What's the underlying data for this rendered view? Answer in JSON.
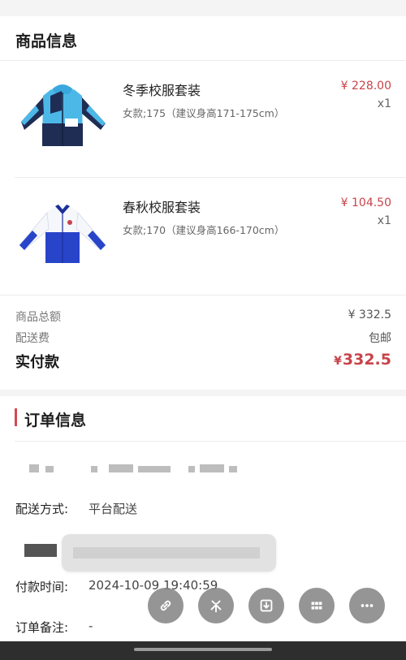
{
  "product_section": {
    "title": "商品信息",
    "items": [
      {
        "name": "冬季校服套装",
        "spec": "女款;175（建议身高171-175cm）",
        "price": "¥ 228.00",
        "qty": "x1",
        "image_icon": "winter-jacket-icon"
      },
      {
        "name": "春秋校服套装",
        "spec": "女款;170（建议身高166-170cm）",
        "price": "¥ 104.50",
        "qty": "x1",
        "image_icon": "spring-jacket-icon"
      }
    ]
  },
  "summary": {
    "subtotal_label": "商品总额",
    "subtotal_value": "¥ 332.5",
    "shipping_label": "配送费",
    "shipping_value": "包邮",
    "paid_label": "实付款",
    "paid_currency": "¥",
    "paid_value": "332.5"
  },
  "order_section": {
    "title": "订单信息",
    "delivery_label": "配送方式:",
    "delivery_value": "平台配送",
    "payment_time_label": "付款时间:",
    "payment_time_value": "2024-10-09 19:40:59",
    "remark_label": "订单备注:",
    "remark_value": "-"
  },
  "floating_toolbar": {
    "buttons": [
      "link-icon",
      "sparkle-icon",
      "download-icon",
      "grid-icon",
      "more-icon"
    ]
  },
  "colors": {
    "price_red": "#c9434a",
    "accent_bar": "#d04b52"
  }
}
